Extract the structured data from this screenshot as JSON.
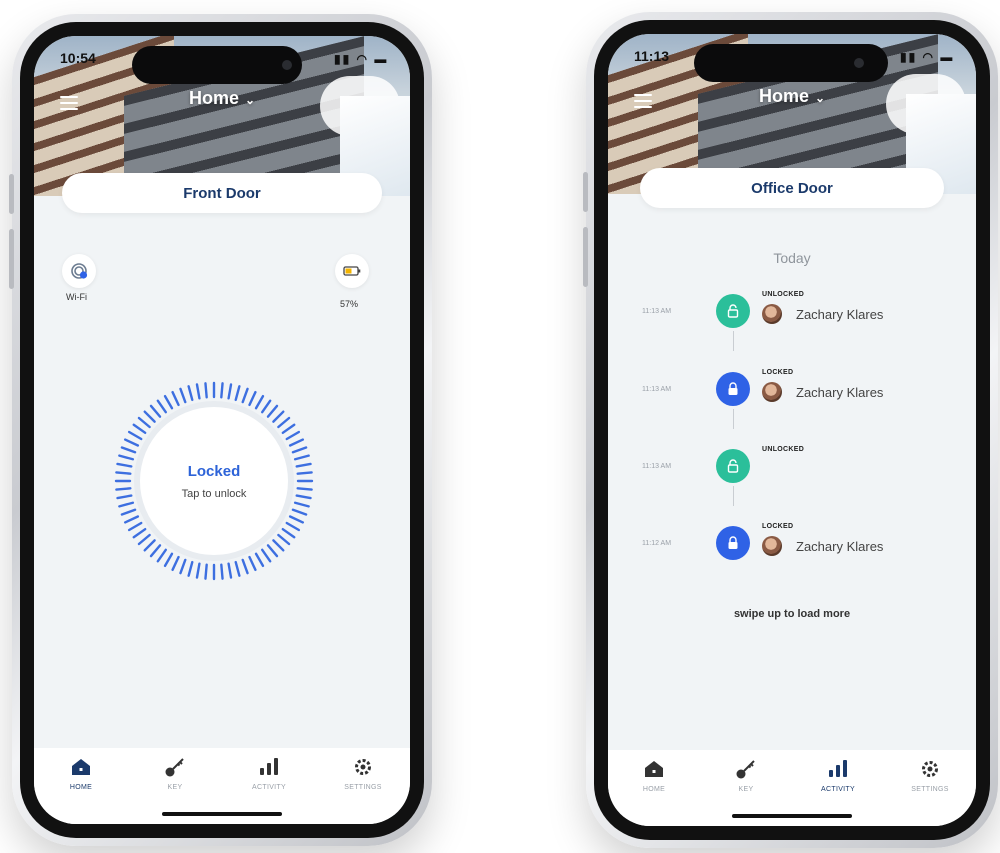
{
  "left_phone": {
    "status_time": "10:54",
    "home_title": "Home",
    "door_name": "Front Door",
    "wifi_label": "Wi-Fi",
    "battery_label": "57%",
    "lock_status": "Locked",
    "lock_hint": "Tap to unlock",
    "tabs": [
      {
        "label": "HOME",
        "icon": "home-icon",
        "active": true
      },
      {
        "label": "KEY",
        "icon": "key-icon",
        "active": false
      },
      {
        "label": "ACTIVITY",
        "icon": "activity-icon",
        "active": false
      },
      {
        "label": "SETTINGS",
        "icon": "gear-icon",
        "active": false
      }
    ]
  },
  "right_phone": {
    "status_time": "11:13",
    "home_title": "Home",
    "door_name": "Office Door",
    "day_header": "Today",
    "events": [
      {
        "time": "11:13 AM",
        "action": "UNLOCKED",
        "state": "unlocked",
        "user": "Zachary Klares"
      },
      {
        "time": "11:13 AM",
        "action": "LOCKED",
        "state": "locked",
        "user": "Zachary Klares"
      },
      {
        "time": "11:13 AM",
        "action": "UNLOCKED",
        "state": "unlocked",
        "user": ""
      },
      {
        "time": "11:12 AM",
        "action": "LOCKED",
        "state": "locked",
        "user": "Zachary Klares"
      }
    ],
    "load_more": "swipe up to load more",
    "tabs": [
      {
        "label": "HOME",
        "icon": "home-icon",
        "active": false
      },
      {
        "label": "KEY",
        "icon": "key-icon",
        "active": false
      },
      {
        "label": "ACTIVITY",
        "icon": "activity-icon",
        "active": true
      },
      {
        "label": "SETTINGS",
        "icon": "gear-icon",
        "active": false
      }
    ]
  },
  "colors": {
    "primary_navy": "#1b3a6b",
    "lock_blue": "#2f62e6",
    "unlock_green": "#2bbf9a",
    "screen_bg": "#f1f4f6"
  }
}
